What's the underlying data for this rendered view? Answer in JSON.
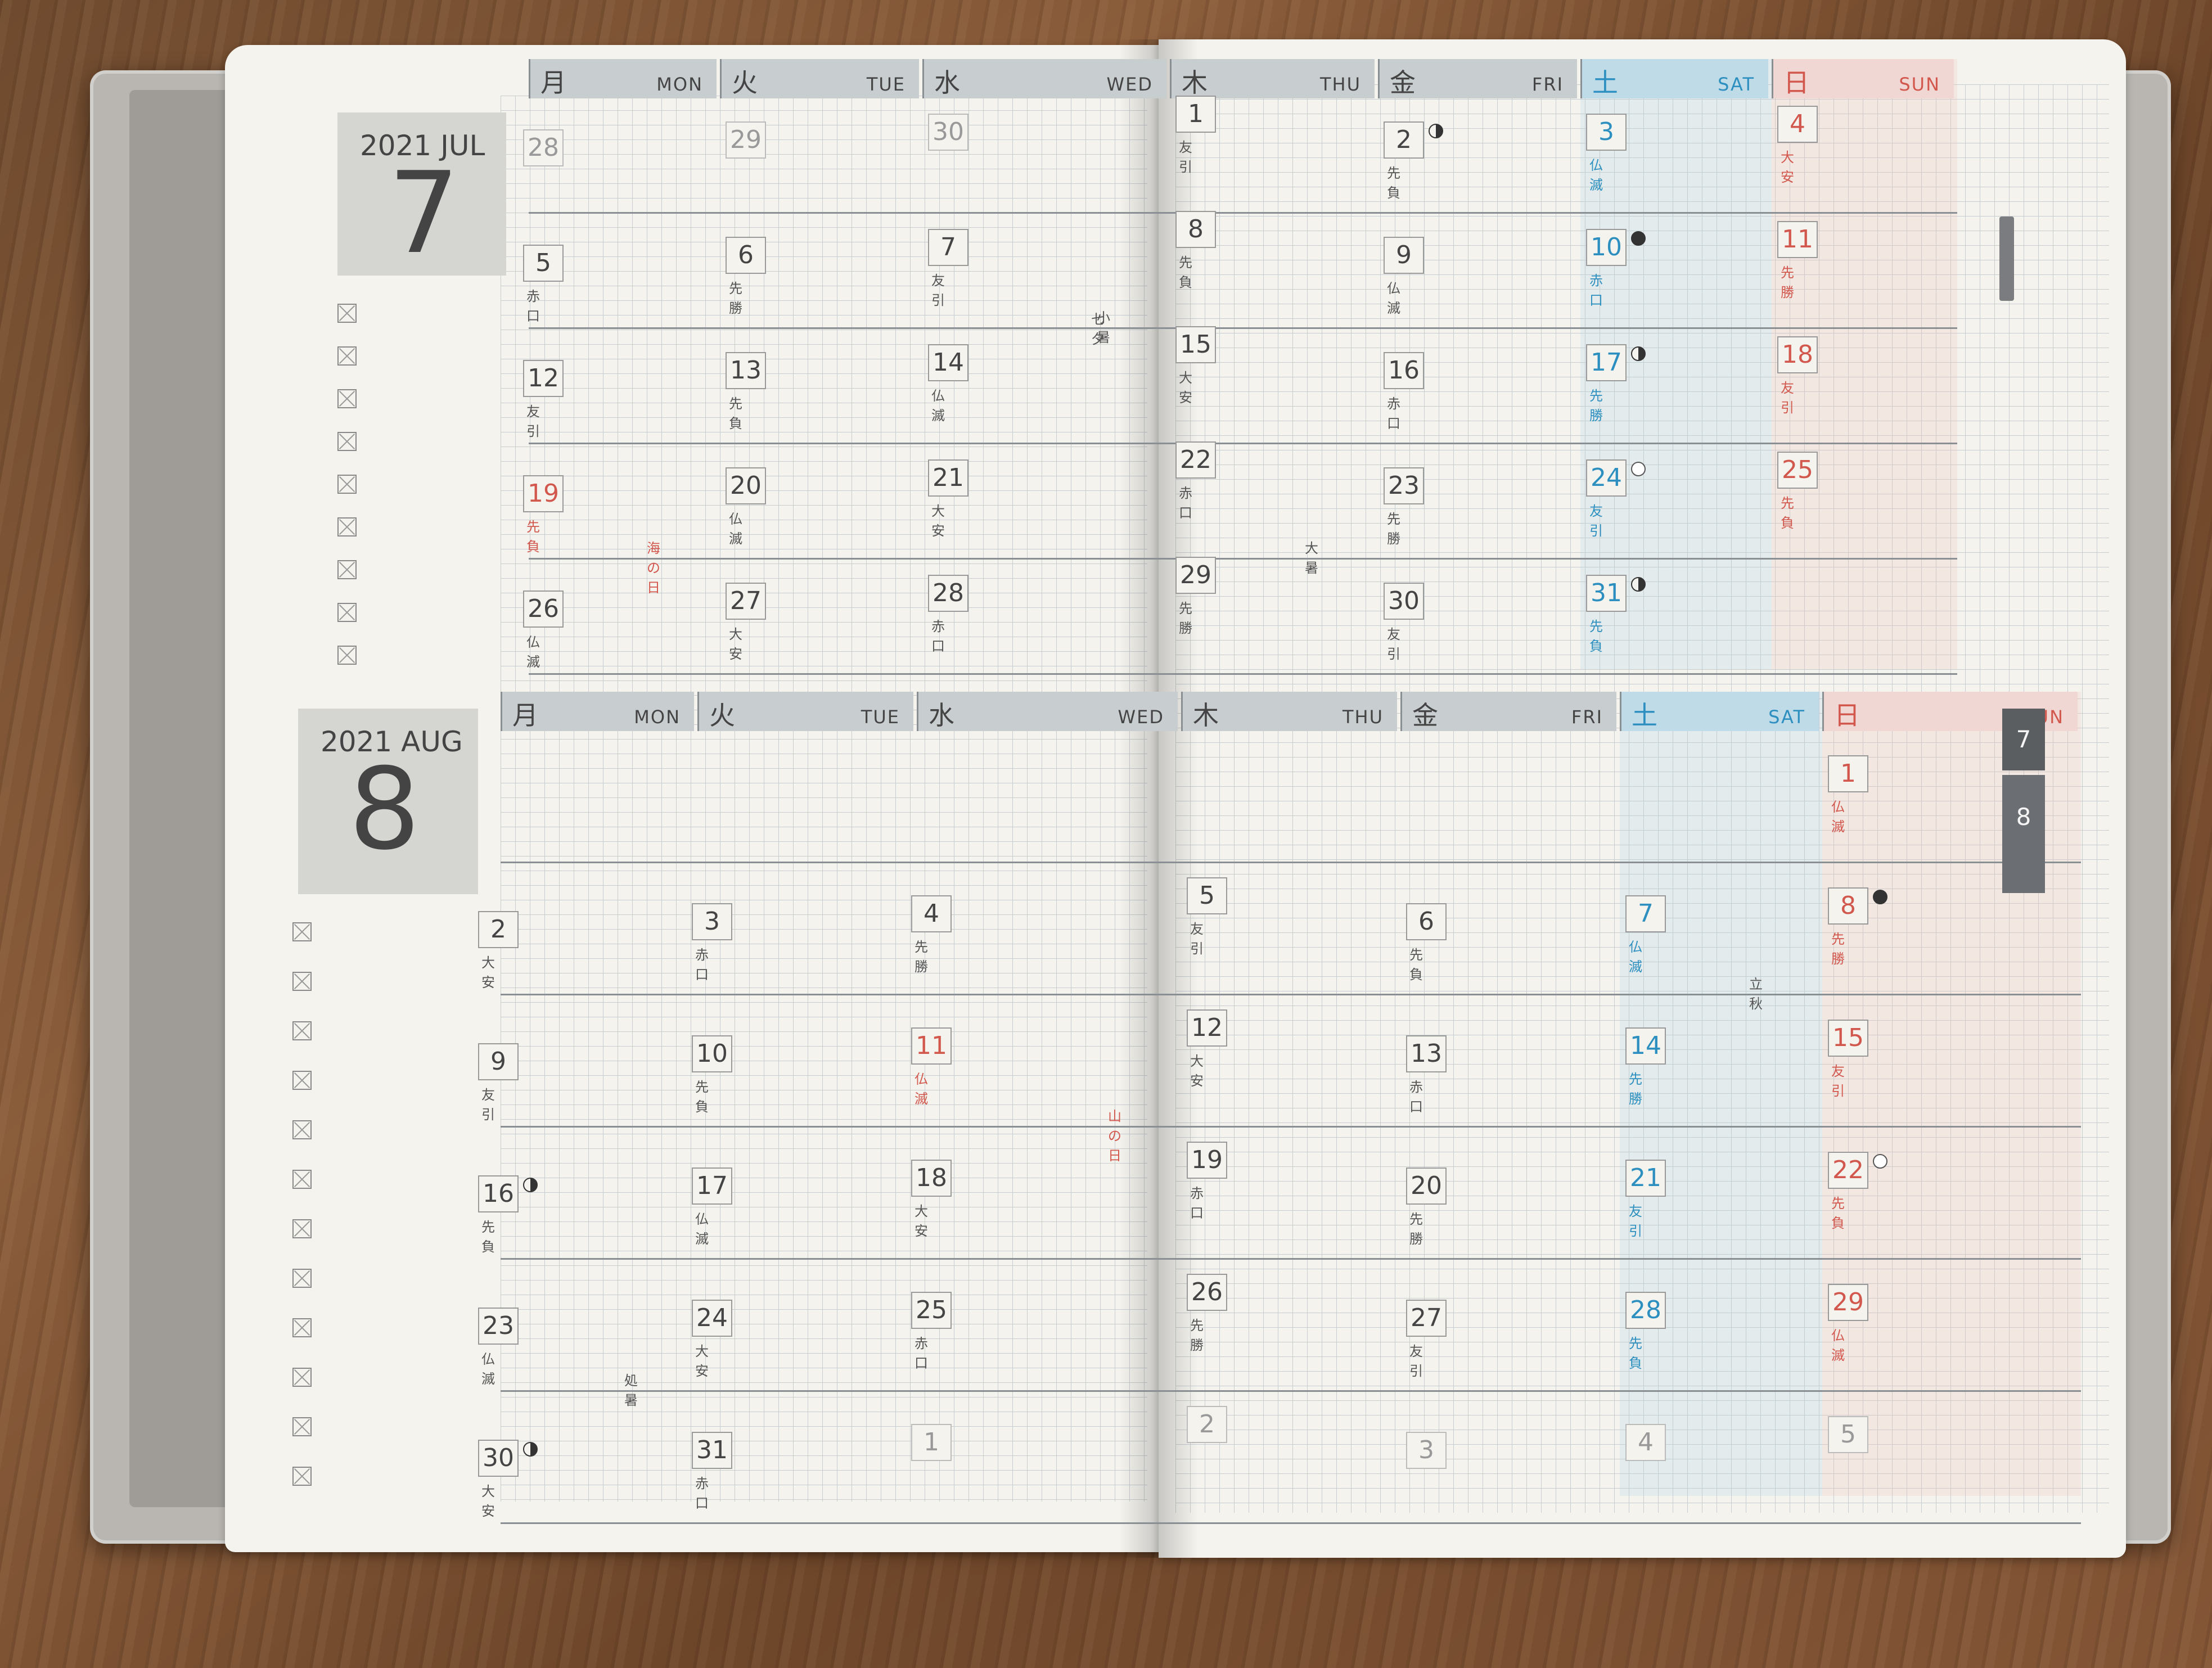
{
  "planner": {
    "july": {
      "year": "2021",
      "month_en": "JUL",
      "month_num": "7",
      "headers": [
        {
          "jp": "月",
          "en": "MON"
        },
        {
          "jp": "火",
          "en": "TUE"
        },
        {
          "jp": "水",
          "en": "WED"
        },
        {
          "jp": "木",
          "en": "THU"
        },
        {
          "jp": "金",
          "en": "FRI"
        },
        {
          "jp": "土",
          "en": "SAT"
        },
        {
          "jp": "日",
          "en": "SUN"
        }
      ],
      "weeks": [
        [
          {
            "d": "28",
            "r": "",
            "dim": true
          },
          {
            "d": "29",
            "r": "",
            "dim": true
          },
          {
            "d": "30",
            "r": "",
            "dim": true
          },
          {
            "d": "1",
            "r": "友引"
          },
          {
            "d": "2",
            "r": "先負",
            "moon": "half"
          },
          {
            "d": "3",
            "r": "仏滅"
          },
          {
            "d": "4",
            "r": "大安"
          }
        ],
        [
          {
            "d": "5",
            "r": "赤口"
          },
          {
            "d": "6",
            "r": "先勝"
          },
          {
            "d": "7",
            "r": "友引",
            "note": "小暑"
          },
          {
            "d": "8",
            "r": "先負"
          },
          {
            "d": "9",
            "r": "仏滅"
          },
          {
            "d": "10",
            "r": "赤口",
            "moon": "new"
          },
          {
            "d": "11",
            "r": "先勝"
          }
        ],
        [
          {
            "d": "12",
            "r": "友引"
          },
          {
            "d": "13",
            "r": "先負"
          },
          {
            "d": "14",
            "r": "仏滅"
          },
          {
            "d": "15",
            "r": "大安"
          },
          {
            "d": "16",
            "r": "赤口"
          },
          {
            "d": "17",
            "r": "先勝",
            "moon": "half"
          },
          {
            "d": "18",
            "r": "友引"
          }
        ],
        [
          {
            "d": "19",
            "r": "先負",
            "red": true,
            "note": "海の日"
          },
          {
            "d": "20",
            "r": "仏滅"
          },
          {
            "d": "21",
            "r": "大安"
          },
          {
            "d": "22",
            "r": "赤口",
            "note": "大暑"
          },
          {
            "d": "23",
            "r": "先勝"
          },
          {
            "d": "24",
            "r": "友引",
            "moon": "full"
          },
          {
            "d": "25",
            "r": "先負"
          }
        ],
        [
          {
            "d": "26",
            "r": "仏滅"
          },
          {
            "d": "27",
            "r": "大安"
          },
          {
            "d": "28",
            "r": "赤口"
          },
          {
            "d": "29",
            "r": "先勝"
          },
          {
            "d": "30",
            "r": "友引"
          },
          {
            "d": "31",
            "r": "先負",
            "moon": "half"
          },
          {
            "d": "",
            "r": ""
          }
        ]
      ],
      "wed_note": "七夕"
    },
    "august": {
      "year": "2021",
      "month_en": "AUG",
      "month_num": "8",
      "headers": [
        {
          "jp": "月",
          "en": "MON"
        },
        {
          "jp": "火",
          "en": "TUE"
        },
        {
          "jp": "水",
          "en": "WED"
        },
        {
          "jp": "木",
          "en": "THU"
        },
        {
          "jp": "金",
          "en": "FRI"
        },
        {
          "jp": "土",
          "en": "SAT"
        },
        {
          "jp": "日",
          "en": "SUN"
        }
      ],
      "weeks": [
        [
          {
            "d": "",
            "r": ""
          },
          {
            "d": "",
            "r": ""
          },
          {
            "d": "",
            "r": ""
          },
          {
            "d": "",
            "r": ""
          },
          {
            "d": "",
            "r": ""
          },
          {
            "d": "",
            "r": ""
          },
          {
            "d": "1",
            "r": "仏滅"
          }
        ],
        [
          {
            "d": "2",
            "r": "大安"
          },
          {
            "d": "3",
            "r": "赤口"
          },
          {
            "d": "4",
            "r": "先勝"
          },
          {
            "d": "5",
            "r": "友引"
          },
          {
            "d": "6",
            "r": "先負"
          },
          {
            "d": "7",
            "r": "仏滅",
            "note": "立秋"
          },
          {
            "d": "8",
            "r": "先勝",
            "moon": "new"
          }
        ],
        [
          {
            "d": "9",
            "r": "友引"
          },
          {
            "d": "10",
            "r": "先負"
          },
          {
            "d": "11",
            "r": "仏滅",
            "red": true,
            "note": "山の日"
          },
          {
            "d": "12",
            "r": "大安"
          },
          {
            "d": "13",
            "r": "赤口"
          },
          {
            "d": "14",
            "r": "先勝"
          },
          {
            "d": "15",
            "r": "友引"
          }
        ],
        [
          {
            "d": "16",
            "r": "先負",
            "moon": "half"
          },
          {
            "d": "17",
            "r": "仏滅"
          },
          {
            "d": "18",
            "r": "大安"
          },
          {
            "d": "19",
            "r": "赤口"
          },
          {
            "d": "20",
            "r": "先勝"
          },
          {
            "d": "21",
            "r": "友引"
          },
          {
            "d": "22",
            "r": "先負",
            "moon": "full"
          }
        ],
        [
          {
            "d": "23",
            "r": "仏滅",
            "note": "処暑"
          },
          {
            "d": "24",
            "r": "大安"
          },
          {
            "d": "25",
            "r": "赤口"
          },
          {
            "d": "26",
            "r": "先勝"
          },
          {
            "d": "27",
            "r": "友引"
          },
          {
            "d": "28",
            "r": "先負"
          },
          {
            "d": "29",
            "r": "仏滅"
          }
        ],
        [
          {
            "d": "30",
            "r": "大安",
            "moon": "half"
          },
          {
            "d": "31",
            "r": "赤口"
          },
          {
            "d": "1",
            "r": "",
            "dim": true
          },
          {
            "d": "2",
            "r": "",
            "dim": true
          },
          {
            "d": "3",
            "r": "",
            "dim": true
          },
          {
            "d": "4",
            "r": "",
            "dim": true
          },
          {
            "d": "5",
            "r": "",
            "dim": true
          }
        ]
      ]
    },
    "side_tabs": [
      "7",
      "8"
    ]
  }
}
